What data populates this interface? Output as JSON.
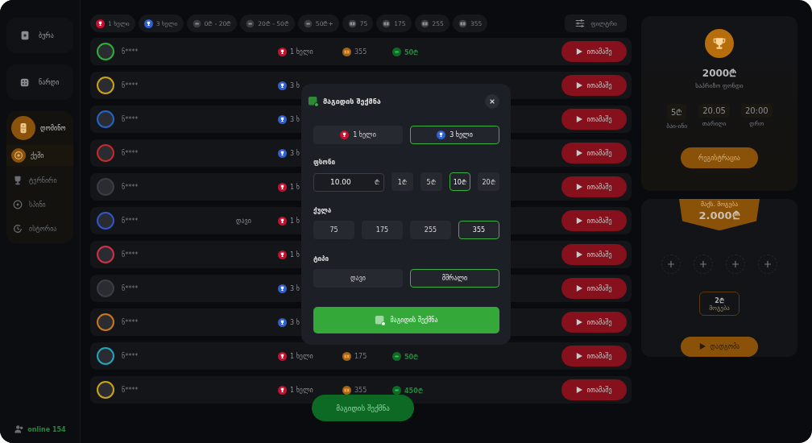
{
  "sidebar": {
    "games": [
      {
        "kind": "cards",
        "label": "ბურა",
        "selected": false
      },
      {
        "kind": "dice",
        "label": "ნარდი",
        "selected": false
      },
      {
        "kind": "domino",
        "label": "დომინო",
        "selected": true,
        "items": [
          {
            "kind": "cash",
            "label": "ქეში",
            "selected": true
          },
          {
            "kind": "trophy",
            "label": "ტურნირი",
            "selected": false
          },
          {
            "kind": "spin",
            "label": "სპინი",
            "selected": false
          },
          {
            "kind": "history",
            "label": "ისტორია",
            "selected": false
          }
        ]
      }
    ],
    "online": "online 154"
  },
  "filters": [
    {
      "kind": "one",
      "label": "1 ხელი"
    },
    {
      "kind": "three",
      "label": "3 ხელი"
    },
    {
      "kind": "coin",
      "label": "0₾ - 20₾"
    },
    {
      "kind": "coin",
      "label": "20₾ - 50₾"
    },
    {
      "kind": "coin",
      "label": "50₾+"
    },
    {
      "kind": "points",
      "label": "75"
    },
    {
      "kind": "points",
      "label": "175"
    },
    {
      "kind": "points",
      "label": "255"
    },
    {
      "kind": "points",
      "label": "355"
    }
  ],
  "filter_button": "ფილტრი",
  "rows": [
    {
      "name": "ნ****",
      "color": "#2fae3a",
      "hands": {
        "kind": "one",
        "label": "1 ხელი"
      },
      "points": "355",
      "bet": "50₾",
      "play": "ითამაშე"
    },
    {
      "name": "ნ****",
      "color": "#c9a416",
      "hands": {
        "kind": "three",
        "label": "3 ხ"
      },
      "play": "ითამაშე"
    },
    {
      "name": "ნ****",
      "color": "#2563c4",
      "hands": {
        "kind": "three",
        "label": "3 ხ"
      },
      "play": "ითამაშე"
    },
    {
      "name": "ნ****",
      "color": "#c42a2a",
      "hands": {
        "kind": "three",
        "label": "3 ხ"
      },
      "play": "ითამაშე"
    },
    {
      "name": "ნ****",
      "color": "#3a3d44",
      "hands": {
        "kind": "one",
        "label": "1 ხ"
      },
      "play": "ითამაშე"
    },
    {
      "name": "ნ****",
      "color": "#3256c8",
      "type": "დავი",
      "hands": {
        "kind": "one",
        "label": "1 ხ"
      },
      "play": "ითამაშე"
    },
    {
      "name": "ნ****",
      "color": "#d0304a",
      "hands": {
        "kind": "one",
        "label": "1 ხ"
      },
      "play": "ითამაშე"
    },
    {
      "name": "ნ****",
      "color": "#3a3d44",
      "hands": {
        "kind": "three",
        "label": "3 ხ"
      },
      "play": "ითამაშე"
    },
    {
      "name": "ნ****",
      "color": "#c8781a",
      "hands": {
        "kind": "three",
        "label": "3 ხ"
      },
      "play": "ითამაშე"
    },
    {
      "name": "ნ****",
      "color": "#21a6b8",
      "hands": {
        "kind": "one",
        "label": "1 ხელი"
      },
      "points": "175",
      "bet": "50₾",
      "play": "ითამაშე"
    },
    {
      "name": "ნ****",
      "color": "#c9a416",
      "hands": {
        "kind": "one",
        "label": "1 ხელი"
      },
      "points": "355",
      "bet": "450₾",
      "play": "ითამაშე"
    }
  ],
  "create_button": "მაგიდის შექმნა",
  "tournament": {
    "prize": "2000₾",
    "prize_label": "საპრიზო ფონდი",
    "stats": [
      {
        "value": "5₾",
        "label": "ბაი-ინი"
      },
      {
        "value": "20.05",
        "label": "თარიღი"
      },
      {
        "value": "20:00",
        "label": "დრო"
      }
    ],
    "button": "რეგისტრაცია"
  },
  "max_win": {
    "label": "მაქს. მოგება",
    "amount": "2.000₾",
    "slots": [
      {
        "filled": false
      },
      {
        "filled": false
      },
      {
        "filled": false
      },
      {
        "filled": false
      }
    ],
    "stake": "2₾",
    "stake_label": "მოგება",
    "button": "დადგომა"
  },
  "modal": {
    "title": "მაგიდის შექმნა",
    "hand_tabs": [
      {
        "kind": "one",
        "label": "1 ხელი",
        "selected": false
      },
      {
        "kind": "three",
        "label": "3 ხელი",
        "selected": true
      }
    ],
    "bet": {
      "label": "ფსონი",
      "value": "10.00",
      "currency": "₾",
      "options": [
        {
          "label": "1₾",
          "selected": false
        },
        {
          "label": "5₾",
          "selected": false
        },
        {
          "label": "10₾",
          "selected": true
        },
        {
          "label": "20₾",
          "selected": false
        }
      ]
    },
    "points": {
      "label": "ქულა",
      "options": [
        {
          "label": "75",
          "selected": false
        },
        {
          "label": "175",
          "selected": false
        },
        {
          "label": "255",
          "selected": false
        },
        {
          "label": "355",
          "selected": true
        }
      ]
    },
    "type": {
      "label": "ტიპი",
      "options": [
        {
          "label": "დავი",
          "selected": false
        },
        {
          "label": "მშრალი",
          "selected": true
        }
      ]
    },
    "submit": "მაგიდის შექმნა"
  }
}
